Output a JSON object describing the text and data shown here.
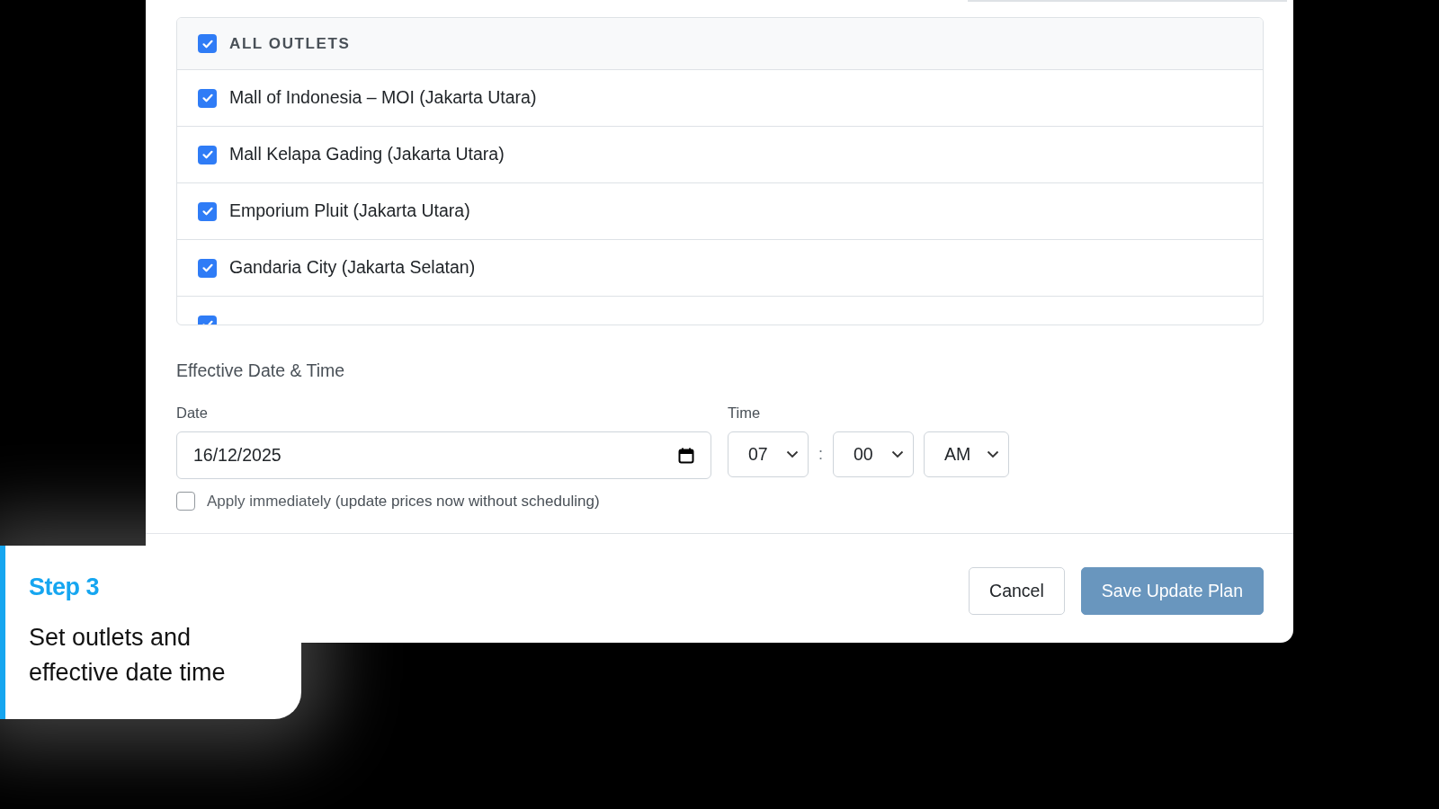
{
  "outlets": {
    "all": {
      "label": "ALL OUTLETS",
      "checked": true
    },
    "items": [
      {
        "label": "Mall of Indonesia – MOI (Jakarta Utara)",
        "checked": true
      },
      {
        "label": "Mall Kelapa Gading (Jakarta Utara)",
        "checked": true
      },
      {
        "label": "Emporium Pluit (Jakarta Utara)",
        "checked": true
      },
      {
        "label": "Gandaria City (Jakarta Selatan)",
        "checked": true
      },
      {
        "checked": true
      }
    ]
  },
  "effective": {
    "title": "Effective Date & Time",
    "date": {
      "label": "Date",
      "value": "16/12/2025"
    },
    "time": {
      "label": "Time",
      "hour": "07",
      "separator": ":",
      "minute": "00",
      "period": "AM"
    },
    "apply_immediately": {
      "label": "Apply immediately (update prices now without scheduling)",
      "checked": false
    }
  },
  "buttons": [
    {
      "label": "Cancel",
      "kind": "secondary",
      "disabled": false
    },
    {
      "label": "Save Update Plan",
      "kind": "primary",
      "disabled": true
    }
  ],
  "callout": {
    "step": "Step 3",
    "text": "Set outlets and effective date time"
  }
}
